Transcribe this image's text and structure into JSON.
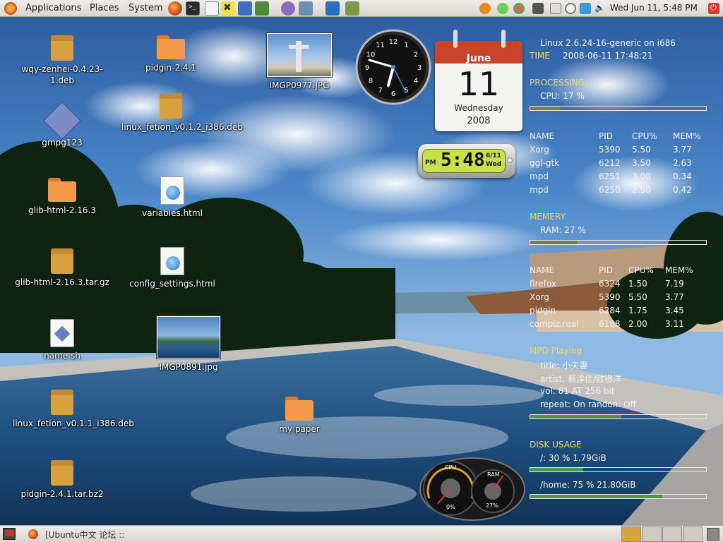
{
  "top_panel": {
    "menus": [
      "Applications",
      "Places",
      "System"
    ],
    "datetime": "Wed Jun 11,  5:48 PM"
  },
  "desktop_icons": {
    "i1": "wqy-zenhei-0.4.23-1.deb",
    "i2": "gmpg123",
    "i3": "glib-html-2.16.3",
    "i4": "glib-html-2.16.3.tar.gz",
    "i5": "name.sh",
    "i6": "linux_fetion_v0.1.1_i386.deb",
    "i7": "pidgin-2.4.1.tar.bz2",
    "i8": "pidgin-2.4.1",
    "i9": "linux_fetion_v0.1.2_i386.deb",
    "i10": "variables.html",
    "i11": "config_settings.html",
    "i12": "IMGP0891.jpg",
    "i13": "IMGP0977.JPG",
    "i14": "my paper"
  },
  "calendar": {
    "month": "June",
    "day": "11",
    "weekday": "Wednesday",
    "year": "2008"
  },
  "digital_clock": {
    "ampm": "PM",
    "time": "5:48",
    "date": "6/11",
    "day": "Wed"
  },
  "analog_clock": {
    "numbers": [
      "12",
      "1",
      "2",
      "3",
      "4",
      "5",
      "6",
      "7",
      "8",
      "9",
      "10",
      "11"
    ]
  },
  "conky": {
    "kernel": "Linux 2.6.24-16-generic on i686",
    "time_label": "TIME",
    "time_value": "2008-06-11 17:48:21",
    "processing_label": "PROCESSING",
    "cpu_line": "CPU:    17 %",
    "cpu_percent": 17,
    "proc_table1": {
      "headers": [
        "NAME",
        "PID",
        "CPU%",
        "MEM%"
      ],
      "rows": [
        [
          "Xorg",
          "5390",
          "5.50",
          "3.77"
        ],
        [
          "ggl-gtk",
          "6212",
          "3.50",
          "2.63"
        ],
        [
          "mpd",
          "6251",
          "3.00",
          "0.34"
        ],
        [
          "mpd",
          "6250",
          "2.50",
          "0.42"
        ]
      ]
    },
    "memery_label": "MEMERY",
    "ram_line": "RAM:    27 %",
    "ram_percent": 27,
    "proc_table2": {
      "headers": [
        "NAME",
        "PID",
        "CPU%",
        "MEM%"
      ],
      "rows": [
        [
          "firefox",
          "6324",
          "1.50",
          "7.19"
        ],
        [
          "Xorg",
          "5390",
          "5.50",
          "3.77"
        ],
        [
          "pidgin",
          "6284",
          "1.75",
          "3.45"
        ],
        [
          "compiz.real",
          "6188",
          "2.00",
          "3.11"
        ]
      ]
    },
    "mpd_label": "MPD   Playing",
    "mpd_title": "title:   小夫妻",
    "mpd_artist": "artist: 蔡淳佳/欧得洋",
    "mpd_vol": "vol:    81   AT    256 bit",
    "mpd_repeat": "repeat: On   randon: Off",
    "mpd_progress": 0.52,
    "disk_label": "DISK USAGE",
    "disk_root": "/:           30 %  1.79GiB",
    "disk_root_percent": 30,
    "disk_home": "/home:    75 %  21.80GiB",
    "disk_home_percent": 75
  },
  "meters": {
    "cpu_label": "CPU",
    "cpu_value": "0%",
    "ram_label": "RAM",
    "ram_value": "27%"
  },
  "bottom_panel": {
    "task_label": "[Ubuntu中文 论坛 ::"
  },
  "colors": {
    "accent_yellow": "#f6d860",
    "bar_green": "#5a8f4a",
    "calendar_red": "#c9432b",
    "clock_lcd": "#c8e04a"
  }
}
